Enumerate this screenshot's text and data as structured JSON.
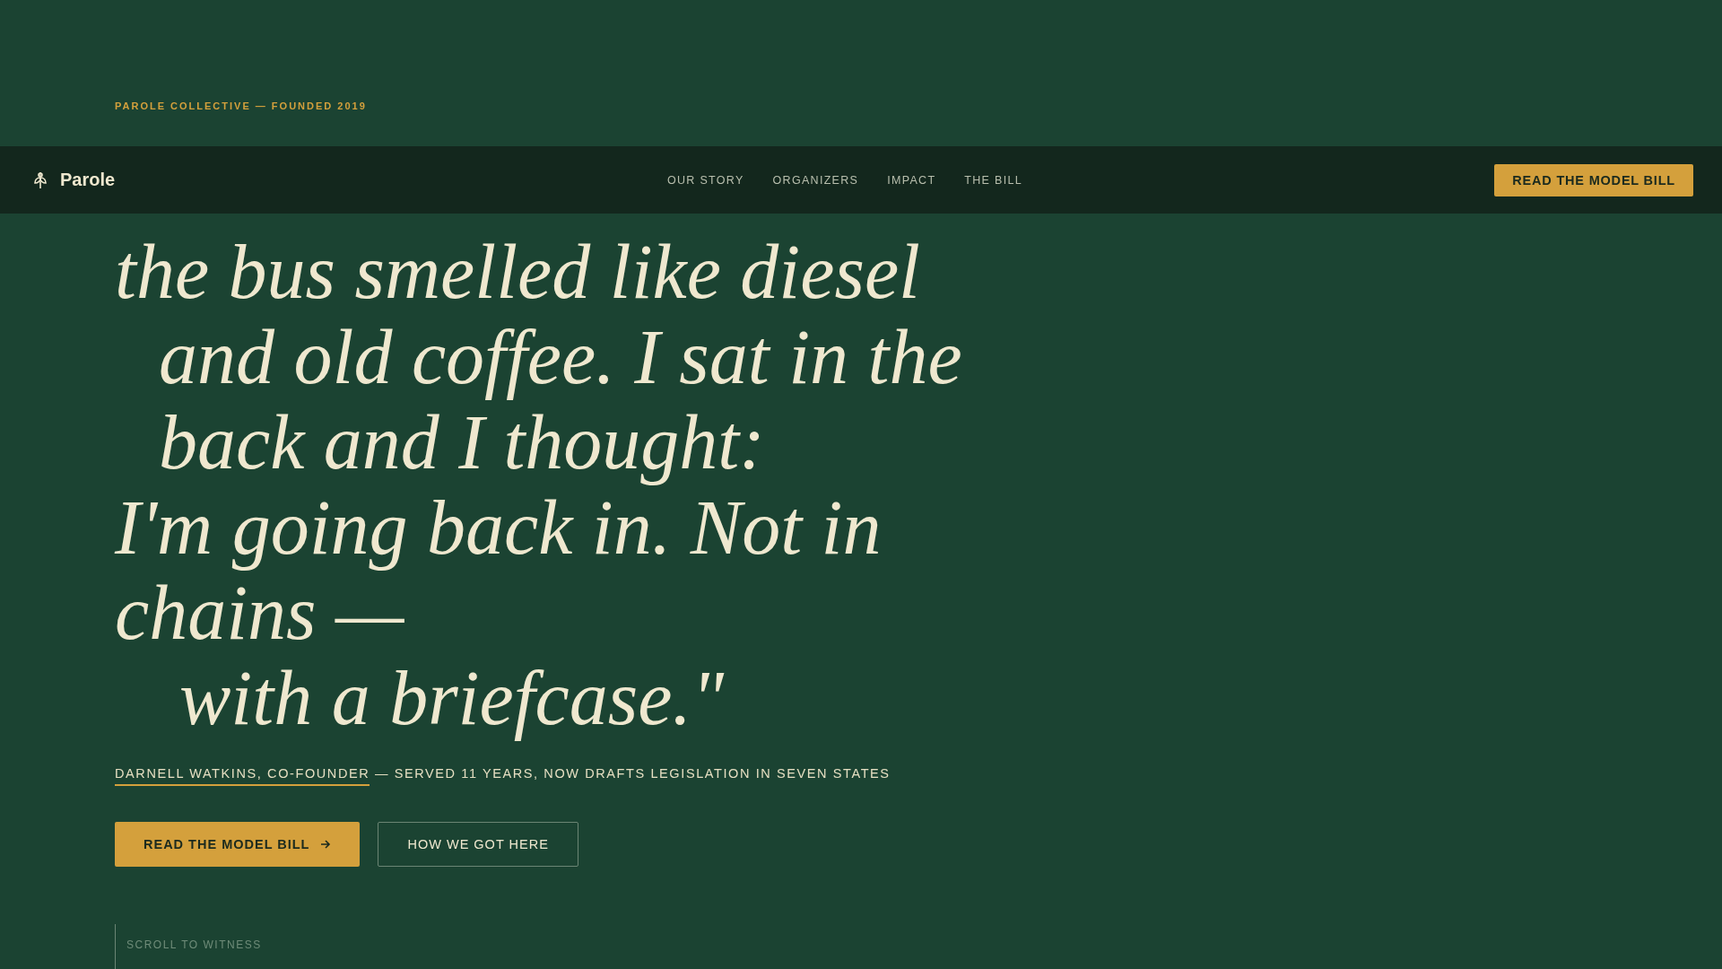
{
  "eyebrow": "PAROLE COLLECTIVE — FOUNDED 2019",
  "nav": {
    "brand": "Parole",
    "links": [
      {
        "label": "OUR STORY"
      },
      {
        "label": "ORGANIZERS"
      },
      {
        "label": "IMPACT"
      },
      {
        "label": "THE BILL"
      }
    ],
    "cta": "READ THE MODEL BILL"
  },
  "quote": {
    "lines": [
      {
        "text": "the bus smelled like diesel",
        "kind": "flush"
      },
      {
        "text": "and old coffee. I sat in the",
        "kind": "indent"
      },
      {
        "text": "back and I thought:",
        "kind": "indent"
      },
      {
        "text": "I'm going back in. Not in chains —",
        "kind": "flush"
      },
      {
        "text": "with a briefcase.\"",
        "kind": "deep"
      }
    ]
  },
  "attribution": {
    "name": "DARNELL WATKINS, CO-FOUNDER",
    "detail": " — SERVED 11 YEARS, NOW DRAFTS LEGISLATION IN SEVEN STATES"
  },
  "buttons": [
    {
      "label": "READ THE MODEL BILL",
      "kind": "primary"
    },
    {
      "label": "HOW WE GOT HERE",
      "kind": "secondary"
    }
  ],
  "scroll_hint": "SCROLL TO WITNESS"
}
